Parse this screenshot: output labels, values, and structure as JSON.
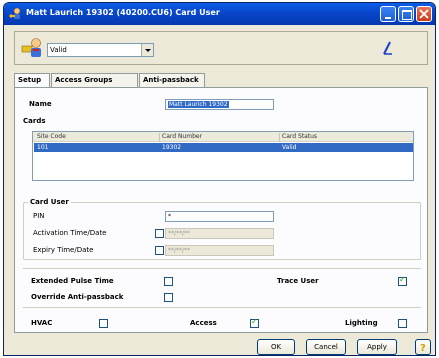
{
  "window": {
    "title": "Matt Laurich 19302  (40200.CU6)  Card User",
    "icon": "user-key-icon"
  },
  "status": {
    "selected": "Valid"
  },
  "tabs": [
    {
      "label": "Setup",
      "active": true
    },
    {
      "label": "Access Groups",
      "active": false
    },
    {
      "label": "Anti-passback",
      "active": false
    }
  ],
  "setup": {
    "name_label": "Name",
    "name_value": "Matt Laurich 19302",
    "cards_label": "Cards",
    "cards_table": {
      "columns": [
        "Site Code",
        "Card Number",
        "Card Status"
      ],
      "rows": [
        [
          "101",
          "19302",
          "Valid"
        ]
      ]
    },
    "card_user_label": "Card User",
    "pin_label": "PIN",
    "pin_value": "*",
    "activation_label": "Activation Time/Date",
    "activation_value": "**/**/**",
    "activation_checked": false,
    "expiry_label": "Expiry Time/Date",
    "expiry_value": "**/**/**",
    "expiry_checked": false,
    "extended_pulse_label": "Extended Pulse Time",
    "extended_pulse_checked": false,
    "trace_user_label": "Trace User",
    "trace_user_checked": true,
    "override_label": "Override Anti-passback",
    "override_checked": false,
    "hvac_label": "HVAC",
    "hvac_checked": false,
    "access_label": "Access",
    "access_checked": true,
    "lighting_label": "Lighting",
    "lighting_checked": false
  },
  "buttons": {
    "ok": "OK",
    "cancel": "Cancel",
    "apply": "Apply",
    "help_icon": "help-icon"
  },
  "colors": {
    "titlebar": "#0846c8",
    "selection": "#316ac5",
    "check": "#21a121"
  }
}
